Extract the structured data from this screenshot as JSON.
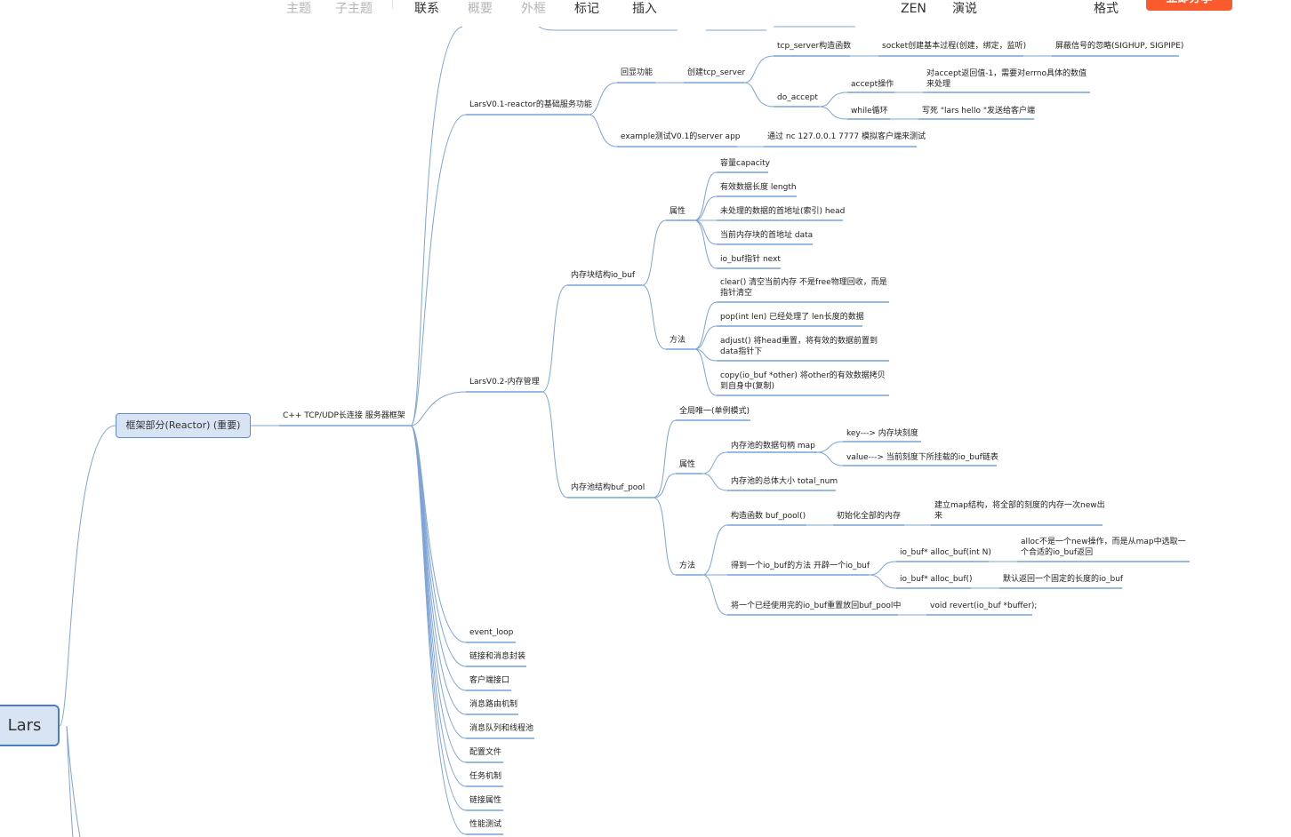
{
  "toolbar": {
    "items": [
      {
        "label": "主题",
        "dim": true
      },
      {
        "label": "子主题",
        "dim": true
      },
      {
        "label": "联系",
        "dim": false
      },
      {
        "label": "概要",
        "dim": true
      },
      {
        "label": "外框",
        "dim": true
      },
      {
        "label": "标记",
        "dim": false
      },
      {
        "label": "插入",
        "dim": false
      },
      {
        "label": "ZEN",
        "dim": false
      },
      {
        "label": "演说",
        "dim": false
      },
      {
        "label": "格式",
        "dim": false
      }
    ],
    "action_button": "立即分享"
  },
  "mindmap": {
    "root": "Lars",
    "framework": "框架部分(Reactor) (重要)",
    "server": "C++ TCP/UDP长连接 服务器框架",
    "v01": {
      "title": "LarsV0.1-reactor的基础服务功能",
      "echo": "回显功能",
      "create": "创建tcp_server",
      "ctor": "tcp_server构造函数",
      "socket": "socket创建基本过程(创建，绑定，监听)",
      "signal": "屏蔽信号的忽略(SIGHUP, SIGPIPE)",
      "do_accept": "do_accept",
      "accept_op": "accept操作",
      "accept_err": "对accept返回值-1，需要对errno具体的数值来处理",
      "while_loop": "while循环",
      "hello": "写死 \"lars hello \"发送给客户端",
      "example": "example测试V0.1的server app",
      "nc": "通过 nc 127.0.0.1 7777 模拟客户端来测试"
    },
    "v02": {
      "title": "LarsV0.2-内存管理",
      "io_buf": "内存块结构io_buf",
      "attrs": "属性",
      "capacity": "容量capacity",
      "length": "有效数据长度 length",
      "head": "未处理的数据的首地址(索引) head",
      "data": "当前内存块的首地址 data",
      "next": "io_buf指针 next",
      "methods": "方法",
      "clear": "clear() 清空当前内存 不是free物理回收，而是指针清空",
      "pop": "pop(int len) 已经处理了 len长度的数据",
      "adjust": "adjust() 将head重置，将有效的数据前置到data指针下",
      "copy": "copy(io_buf *other) 将other的有效数据拷贝到自身中(复制)",
      "buf_pool": "内存池结构buf_pool",
      "singleton": "全局唯一(单例模式)",
      "pool_attrs": "属性",
      "map": "内存池的数据句柄 map",
      "key": "key---> 内存块刻度",
      "value": "value---> 当前刻度下所挂载的io_buf链表",
      "total": "内存池的总体大小 total_num",
      "pool_methods": "方法",
      "pool_ctor": "构造函数 buf_pool()",
      "init_mem": "初始化全部的内存",
      "build_map": "建立map结构，将全部的刻度的内存一次new出来",
      "get_buf": "得到一个io_buf的方法 开辟一个io_buf",
      "alloc_n": "io_buf* alloc_buf(int N)",
      "alloc_n_desc": "alloc不是一个new操作，而是从map中选取一个合适的io_buf返回",
      "alloc_default": "io_buf* alloc_buf()",
      "alloc_default_desc": "默认返回一个固定的长度的io_buf",
      "revert_desc": "将一个已经使用完的io_buf重置放回buf_pool中",
      "revert": "void revert(io_buf *buffer);"
    },
    "others": [
      "event_loop",
      "链接和消息封装",
      "客户端接口",
      "消息路由机制",
      "消息队列和线程池",
      "配置文件",
      "任务机制",
      "链接属性",
      "性能测试"
    ]
  }
}
